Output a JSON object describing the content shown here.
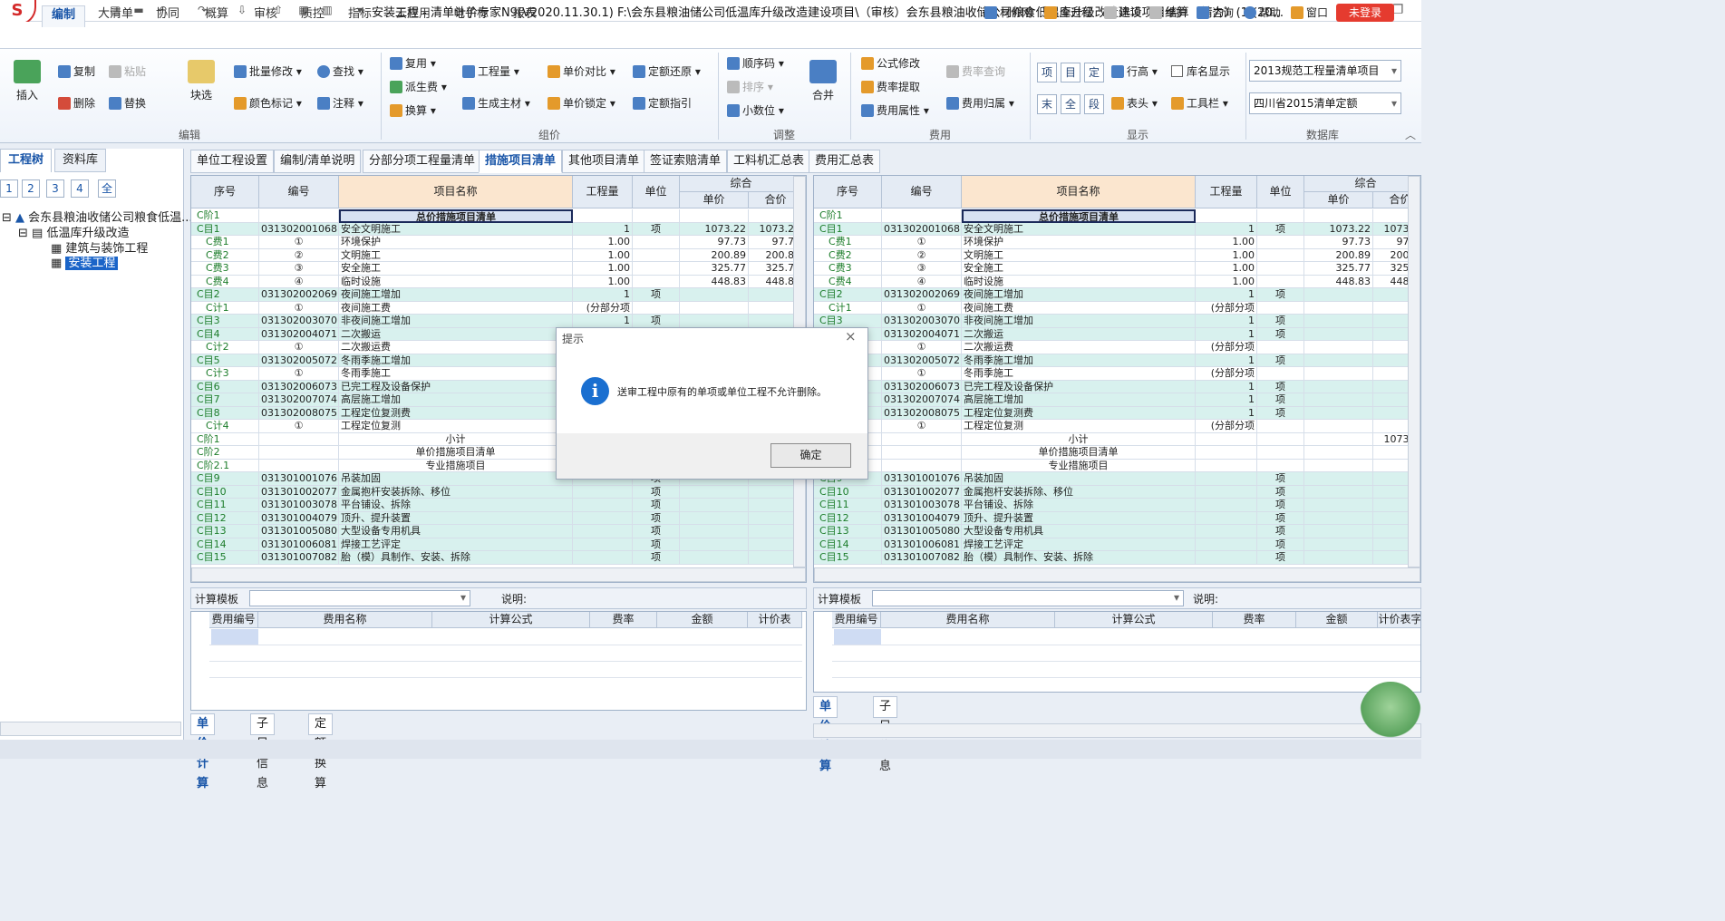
{
  "window": {
    "title": "安装工程 - 清单计价专家N9(V2020.11.30.1) F:\\会东县粮油储公司低温库升级改造建设项目\\（审核）会东县粮油收储公司粮食低温库升级改造建设项目结算（精力）(1)(20..."
  },
  "menu": {
    "tabs": [
      "编制",
      "大清单",
      "协同",
      "概算",
      "审核",
      "质控",
      "指标",
      "云应用",
      "电子标",
      "报表"
    ],
    "right": [
      "材价网",
      "全过程",
      "选项",
      "维护",
      "咨询",
      "帮助",
      "窗口"
    ],
    "login": "未登录"
  },
  "ribbon": {
    "edit": {
      "label": "编辑",
      "insert": "插入",
      "copy": "复制",
      "paste": "粘贴",
      "delete": "删除",
      "replace": "替换",
      "batch": "批量修改",
      "find": "查找",
      "color": "颜色标记",
      "note": "注释",
      "select": "块选"
    },
    "price": {
      "label": "组价",
      "reuse": "复用",
      "derive": "派生费",
      "convert": "换算",
      "qty": "工程量",
      "gen": "生成主材",
      "compare": "单价对比",
      "lock": "单价锁定",
      "restore": "定额还原",
      "guide": "定额指引"
    },
    "adjust": {
      "label": "调整",
      "order": "顺序码",
      "sort": "排序",
      "decimal": "小数位",
      "merge": "合并"
    },
    "fee": {
      "label": "费用",
      "formula": "公式修改",
      "rate": "费率提取",
      "attr": "费用属性",
      "ratequery": "费率查询",
      "belong": "费用归属"
    },
    "show": {
      "label": "显示",
      "b1": "项",
      "b2": "目",
      "b3": "定",
      "b4": "末",
      "b5": "全",
      "b6": "段",
      "rowh": "行高",
      "libname": "库名显示",
      "header": "表头",
      "toolbar": "工具栏"
    },
    "db": {
      "label": "数据库",
      "sel1": "2013规范工程量清单项目",
      "sel2": "四川省2015清单定额"
    }
  },
  "left": {
    "tabs": [
      "工程树",
      "资料库"
    ],
    "levels": [
      "1",
      "2",
      "3",
      "4",
      "全"
    ],
    "tree": [
      "会东县粮油收储公司粮食低温...",
      "低温库升级改造",
      "建筑与装饰工程",
      "安装工程"
    ]
  },
  "doc_tabs": [
    "单位工程设置",
    "编制/清单说明",
    "分部分项工程量清单",
    "措施项目清单",
    "其他项目清单",
    "签证索赔清单",
    "工料机汇总表",
    "费用汇总表"
  ],
  "grid": {
    "headers": {
      "seq": "序号",
      "code": "编号",
      "name": "项目名称",
      "qty": "工程量",
      "unit": "单位",
      "comp": "综合",
      "price": "单价",
      "total": "合价"
    },
    "rows": [
      {
        "s": "C阶1",
        "c": "",
        "n": "总价措施项目清单",
        "q": "",
        "u": "",
        "p": "",
        "t": "",
        "k": "head"
      },
      {
        "s": "C目1",
        "c": "031302001068",
        "n": "安全文明施工",
        "q": "1",
        "u": "项",
        "p": "1073.22",
        "t": "1073.22",
        "k": "teal"
      },
      {
        "s": "C费1",
        "c": "①",
        "n": "环境保护",
        "q": "1.00",
        "u": "",
        "p": "97.73",
        "t": "97.73",
        "k": ""
      },
      {
        "s": "C费2",
        "c": "②",
        "n": "文明施工",
        "q": "1.00",
        "u": "",
        "p": "200.89",
        "t": "200.89",
        "k": ""
      },
      {
        "s": "C费3",
        "c": "③",
        "n": "安全施工",
        "q": "1.00",
        "u": "",
        "p": "325.77",
        "t": "325.77",
        "k": ""
      },
      {
        "s": "C费4",
        "c": "④",
        "n": "临时设施",
        "q": "1.00",
        "u": "",
        "p": "448.83",
        "t": "448.83",
        "k": ""
      },
      {
        "s": "C目2",
        "c": "031302002069",
        "n": "夜间施工增加",
        "q": "1",
        "u": "项",
        "p": "",
        "t": "",
        "k": "teal"
      },
      {
        "s": "C计1",
        "c": "①",
        "n": "夜间施工费",
        "q": "(分部分项",
        "u": "",
        "p": "",
        "t": "",
        "k": ""
      },
      {
        "s": "C目3",
        "c": "031302003070",
        "n": "非夜间施工增加",
        "q": "1",
        "u": "项",
        "p": "",
        "t": "",
        "k": "teal"
      },
      {
        "s": "C目4",
        "c": "031302004071",
        "n": "二次搬运",
        "q": "1",
        "u": "项",
        "p": "",
        "t": "",
        "k": "teal"
      },
      {
        "s": "C计2",
        "c": "①",
        "n": "二次搬运费",
        "q": "(分部分项",
        "u": "",
        "p": "",
        "t": "",
        "k": ""
      },
      {
        "s": "C目5",
        "c": "031302005072",
        "n": "冬雨季施工增加",
        "q": "1",
        "u": "项",
        "p": "",
        "t": "",
        "k": "teal"
      },
      {
        "s": "C计3",
        "c": "①",
        "n": "冬雨季施工",
        "q": "(分部分项",
        "u": "",
        "p": "",
        "t": "",
        "k": ""
      },
      {
        "s": "C目6",
        "c": "031302006073",
        "n": "已完工程及设备保护",
        "q": "1",
        "u": "项",
        "p": "",
        "t": "",
        "k": "teal"
      },
      {
        "s": "C目7",
        "c": "031302007074",
        "n": "高层施工增加",
        "q": "1",
        "u": "项",
        "p": "",
        "t": "",
        "k": "teal"
      },
      {
        "s": "C目8",
        "c": "031302008075",
        "n": "工程定位复测费",
        "q": "1",
        "u": "项",
        "p": "",
        "t": "",
        "k": "teal"
      },
      {
        "s": "C计4",
        "c": "①",
        "n": "工程定位复测",
        "q": "(分部分项",
        "u": "",
        "p": "",
        "t": "",
        "k": ""
      },
      {
        "s": "C阶1",
        "c": "",
        "n": "小计",
        "q": "",
        "u": "",
        "p": "",
        "t": "1073.22",
        "k": "sub"
      },
      {
        "s": "C阶2",
        "c": "",
        "n": "单价措施项目清单",
        "q": "",
        "u": "",
        "p": "",
        "t": "",
        "k": "sub"
      },
      {
        "s": "C阶2.1",
        "c": "",
        "n": "专业措施项目",
        "q": "",
        "u": "",
        "p": "",
        "t": "",
        "k": "sub"
      },
      {
        "s": "C目9",
        "c": "031301001076",
        "n": "吊装加固",
        "q": "",
        "u": "项",
        "p": "",
        "t": "",
        "k": "teal"
      },
      {
        "s": "C目10",
        "c": "031301002077",
        "n": "金属抱杆安装拆除、移位",
        "q": "",
        "u": "项",
        "p": "",
        "t": "",
        "k": "teal"
      },
      {
        "s": "C目11",
        "c": "031301003078",
        "n": "平台铺设、拆除",
        "q": "",
        "u": "项",
        "p": "",
        "t": "",
        "k": "teal"
      },
      {
        "s": "C目12",
        "c": "031301004079",
        "n": "顶升、提升装置",
        "q": "",
        "u": "项",
        "p": "",
        "t": "",
        "k": "teal"
      },
      {
        "s": "C目13",
        "c": "031301005080",
        "n": "大型设备专用机具",
        "q": "",
        "u": "项",
        "p": "",
        "t": "",
        "k": "teal"
      },
      {
        "s": "C目14",
        "c": "031301006081",
        "n": "焊接工艺评定",
        "q": "",
        "u": "项",
        "p": "",
        "t": "",
        "k": "teal"
      },
      {
        "s": "C目15",
        "c": "031301007082",
        "n": "胎（模）具制作、安装、拆除",
        "q": "",
        "u": "项",
        "p": "",
        "t": "",
        "k": "teal"
      }
    ]
  },
  "calc": {
    "template_label": "计算模板",
    "desc_label": "说明:",
    "headers": [
      "费用编号",
      "费用名称",
      "计算公式",
      "费率",
      "金额",
      "计价表"
    ],
    "headers_r": [
      "费用编号",
      "费用名称",
      "计算公式",
      "费率",
      "金额",
      "计价表字"
    ]
  },
  "subtabs_left": [
    "单价计算",
    "子目信息",
    "定额换算"
  ],
  "subtabs_right": [
    "单价计算",
    "子目信息"
  ],
  "dialog": {
    "title": "提示",
    "message": "送审工程中原有的单项或单位工程不允许删除。",
    "ok": "确定"
  }
}
